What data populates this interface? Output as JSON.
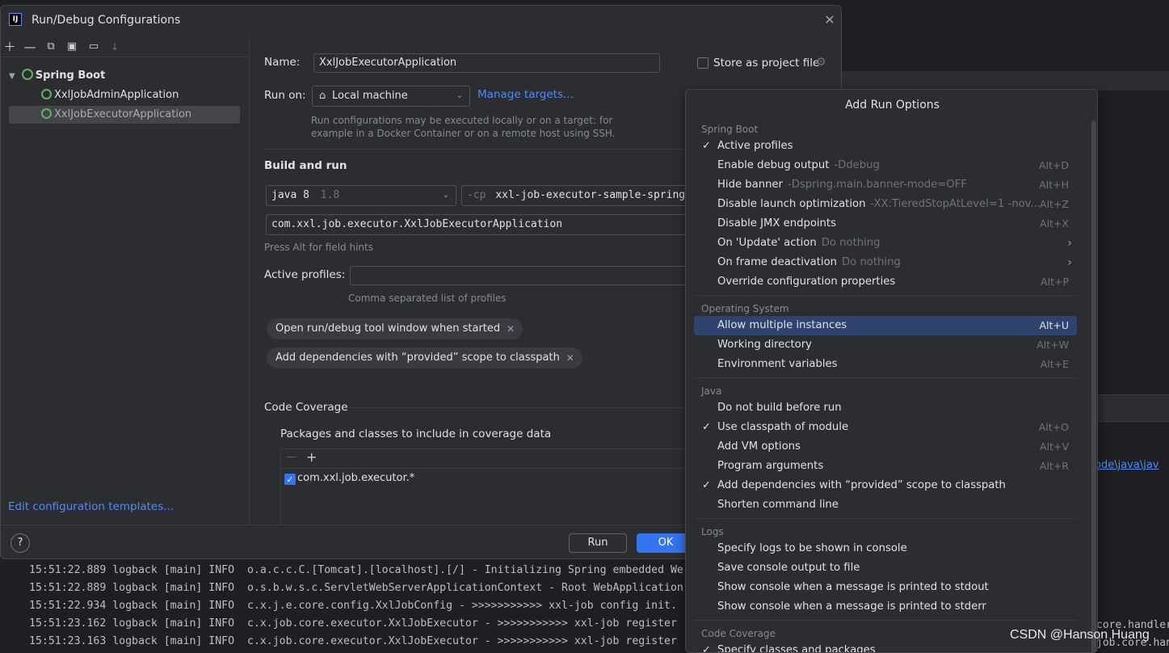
{
  "dialog": {
    "title": "Run/Debug Configurations",
    "app_icon": "intellij-icon",
    "toolbar_icons": [
      "add-icon",
      "remove-icon",
      "copy-icon",
      "save-icon",
      "folder-add-icon",
      "sort-icon"
    ],
    "tree": {
      "group": "Spring Boot",
      "items": [
        "XxlJobAdminApplication",
        "XxlJobExecutorApplication"
      ],
      "selected": "XxlJobExecutorApplication"
    },
    "edit_templates_link": "Edit configuration templates...",
    "form": {
      "name_label": "Name:",
      "name_value": "XxlJobExecutorApplication",
      "store_label": "Store as project file",
      "run_on_label": "Run on:",
      "run_on_value": "Local machine",
      "manage_targets": "Manage targets...",
      "run_on_hint_1": "Run configurations may be executed locally or on a target: for",
      "run_on_hint_2": "example in a Docker Container or on a remote host using SSH.",
      "build_and_run": "Build and run",
      "jdk_value": "java 8",
      "jdk_version": "1.8",
      "cp_prefix": "-cp",
      "cp_value": "xxl-job-executor-sample-spring",
      "main_class": "com.xxl.job.executor.XxlJobExecutorApplication",
      "field_hint": "Press Alt for field hints",
      "active_profiles_label": "Active profiles:",
      "active_profiles_value": "",
      "active_profiles_hint": "Comma separated list of profiles",
      "chips": [
        "Open run/debug tool window when started",
        "Add dependencies with “provided” scope to classpath"
      ],
      "code_coverage": "Code Coverage",
      "coverage_sub": "Packages and classes to include in coverage data",
      "coverage_items": [
        "com.xxl.job.executor.*"
      ]
    },
    "footer": {
      "help": "?",
      "run": "Run",
      "ok": "OK"
    }
  },
  "popup": {
    "title": "Add Run Options",
    "groups": [
      {
        "label": "Spring Boot",
        "options": [
          {
            "checked": true,
            "name": "Active profiles",
            "desc": "",
            "shortcut": ""
          },
          {
            "checked": false,
            "name": "Enable debug output",
            "desc": "-Ddebug",
            "shortcut": "Alt+D"
          },
          {
            "checked": false,
            "name": "Hide banner",
            "desc": "-Dspring.main.banner-mode=OFF",
            "shortcut": "Alt+H"
          },
          {
            "checked": false,
            "name": "Disable launch optimization",
            "desc": "-XX:TieredStopAtLevel=1 -nov...",
            "shortcut": "Alt+Z"
          },
          {
            "checked": false,
            "name": "Disable JMX endpoints",
            "desc": "",
            "shortcut": "Alt+X"
          },
          {
            "checked": false,
            "name": "On 'Update' action",
            "desc": "Do nothing",
            "shortcut": "",
            "submenu": true
          },
          {
            "checked": false,
            "name": "On frame deactivation",
            "desc": "Do nothing",
            "shortcut": "",
            "submenu": true
          },
          {
            "checked": false,
            "name": "Override configuration properties",
            "desc": "",
            "shortcut": "Alt+P"
          }
        ]
      },
      {
        "label": "Operating System",
        "options": [
          {
            "checked": false,
            "name": "Allow multiple instances",
            "desc": "",
            "shortcut": "Alt+U",
            "selected": true
          },
          {
            "checked": false,
            "name": "Working directory",
            "desc": "",
            "shortcut": "Alt+W"
          },
          {
            "checked": false,
            "name": "Environment variables",
            "desc": "",
            "shortcut": "Alt+E"
          }
        ]
      },
      {
        "label": "Java",
        "options": [
          {
            "checked": false,
            "name": "Do not build before run",
            "desc": "",
            "shortcut": ""
          },
          {
            "checked": true,
            "name": "Use classpath of module",
            "desc": "",
            "shortcut": "Alt+O"
          },
          {
            "checked": false,
            "name": "Add VM options",
            "desc": "",
            "shortcut": "Alt+V"
          },
          {
            "checked": false,
            "name": "Program arguments",
            "desc": "",
            "shortcut": "Alt+R"
          },
          {
            "checked": true,
            "name": "Add dependencies with “provided” scope to classpath",
            "desc": "",
            "shortcut": ""
          },
          {
            "checked": false,
            "name": "Shorten command line",
            "desc": "",
            "shortcut": ""
          }
        ]
      },
      {
        "label": "Logs",
        "options": [
          {
            "checked": false,
            "name": "Specify logs to be shown in console",
            "desc": "",
            "shortcut": ""
          },
          {
            "checked": false,
            "name": "Save console output to file",
            "desc": "",
            "shortcut": ""
          },
          {
            "checked": false,
            "name": "Show console when a message is printed to stdout",
            "desc": "",
            "shortcut": ""
          },
          {
            "checked": false,
            "name": "Show console when a message is printed to stderr",
            "desc": "",
            "shortcut": ""
          }
        ]
      },
      {
        "label": "Code Coverage",
        "options": [
          {
            "checked": true,
            "name": "Specify classes and packages",
            "desc": "",
            "shortcut": ""
          }
        ]
      }
    ]
  },
  "background": {
    "path_link": "ode\\java\\jav",
    "right_text_1": "core.handler",
    "right_text_2": "job.core.han",
    "console_lines": [
      "15:51:22.889 logback [main] INFO  o.a.c.c.C.[Tomcat].[localhost].[/] - Initializing Spring embedded We",
      "15:51:22.889 logback [main] INFO  o.s.b.w.s.c.ServletWebServerApplicationContext - Root WebApplication",
      "15:51:22.934 logback [main] INFO  c.x.j.e.core.config.XxlJobConfig - >>>>>>>>>>> xxl-job config init.",
      "15:51:23.162 logback [main] INFO  c.x.job.core.executor.XxlJobExecutor - >>>>>>>>>>> xxl-job register",
      "15:51:23.163 logback [main] INFO  c.x.job.core.executor.XxlJobExecutor - >>>>>>>>>>> xxl-job register"
    ],
    "watermark": "CSDN @Hanson Huang"
  }
}
